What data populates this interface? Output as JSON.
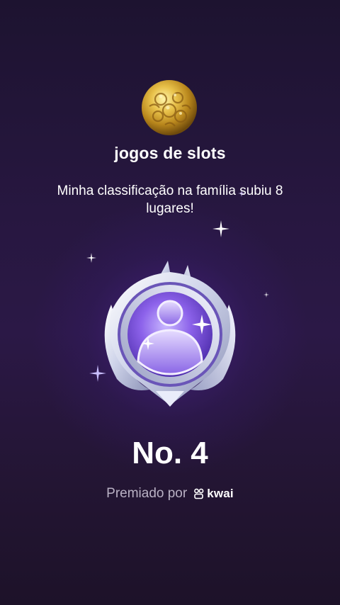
{
  "header": {
    "avatar_icon": "gold-ornament-avatar",
    "group_name": "jogos de slots",
    "message": "Minha classificação na família subiu 8 lugares!"
  },
  "award": {
    "medal_icon": "silver-family-medal",
    "rank_text": "No. 4"
  },
  "footer": {
    "awarded_by_label": "Premiado por",
    "brand_icon": "kwai-logo",
    "brand_name": "kwai"
  },
  "colors": {
    "background_top": "#1d1330",
    "background_mid": "#2b1846",
    "medal_purple": "#7a4de0",
    "medal_silver": "#dfe3f3",
    "footer_text": "#b9b1c4"
  }
}
